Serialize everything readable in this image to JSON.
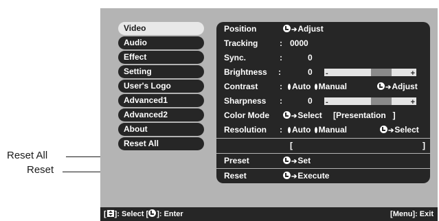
{
  "callouts": {
    "reset_all": "Reset All",
    "reset": "Reset"
  },
  "menu": {
    "items": [
      "Video",
      "Audio",
      "Effect",
      "Setting",
      "User's Logo",
      "Advanced1",
      "Advanced2",
      "About",
      "Reset All"
    ],
    "selected": "Video"
  },
  "panel": {
    "position": {
      "label": "Position",
      "action": "Adjust"
    },
    "tracking": {
      "label": "Tracking",
      "sep": ":",
      "value": "0000"
    },
    "sync": {
      "label": "Sync.",
      "sep": ":",
      "value": "0"
    },
    "brightness": {
      "label": "Brightness",
      "sep": ":",
      "value": "0",
      "minus": "-",
      "plus": "+"
    },
    "contrast": {
      "label": "Contrast",
      "sep": ":",
      "opt1": "Auto",
      "opt2": "Manual",
      "action": "Adjust"
    },
    "sharpness": {
      "label": "Sharpness",
      "sep": ":",
      "value": "0",
      "minus": "-",
      "plus": "+"
    },
    "color_mode": {
      "label": "Color Mode",
      "action": "Select",
      "value": "[Presentation   ]"
    },
    "resolution": {
      "label": "Resolution",
      "sep": ":",
      "opt1": "Auto",
      "opt2": "Manual",
      "action": "Select"
    },
    "resolution_bracket_open": "[",
    "resolution_bracket_close": "]",
    "preset": {
      "label": "Preset",
      "action": "Set"
    },
    "reset": {
      "label": "Reset",
      "action": "Execute"
    }
  },
  "footer": {
    "select_text": "]: Select  [",
    "enter_text": "]: Enter",
    "exit_text": "[Menu]: Exit"
  },
  "colors": {
    "background": "#b4b4b4",
    "panel": "#262626",
    "selected": "#e8e8e8"
  }
}
